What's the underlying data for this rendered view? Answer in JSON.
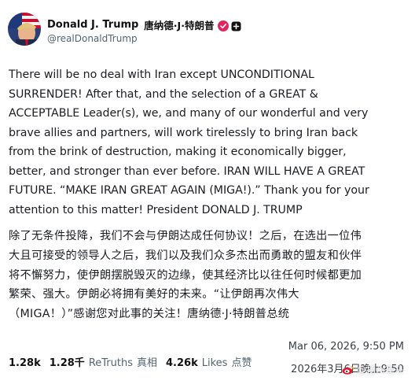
{
  "header": {
    "display_name": "Donald J. Trump",
    "display_name_cn": "唐纳德·J·特朗普",
    "handle": "@realDonaldTrump",
    "verified_icon": "verified-badge-icon",
    "plus_icon": "plus-square-icon",
    "accent_color": "#e0245e"
  },
  "post": {
    "english_lines": [
      "There will be no deal with Iran except UNCONDITIONAL",
      "SURRENDER! After that, and the selection of a GREAT &",
      "ACCEPTABLE Leader(s), we, and many of our wonderful and very",
      "brave allies and partners, will work tirelessly to bring Iran back",
      "from the brink of destruction, making it economically bigger,",
      "better, and stronger than ever before. IRAN WILL HAVE A GREAT",
      "FUTURE. “MAKE IRAN GREAT AGAIN (MIGA!).” Thank you for your",
      "attention to this matter! President DONALD J. TRUMP"
    ],
    "chinese_lines": [
      "除了无条件投降，我们不会与伊朗达成任何协议！之后，在选出一位伟",
      "大且可接受的领导人之后，我们以及我们众多杰出而勇敢的盟友和伙伴",
      "将不懈努力，使伊朗摆脱毁灭的边缘，使其经济比以往任何时候都更加",
      "繁荣、强大。伊朗必将拥有美好的未来。“让伊朗再次伟大",
      "（MIGA！）”感谢您对此事的关注！唐纳德·J·特朗普总统"
    ]
  },
  "footer": {
    "timestamp_en": "Mar 06, 2026, 9:50 PM",
    "timestamp_cn": "2026年3月6日晚上9:50",
    "replies_count": "1.28k",
    "retruths_count": "1.28千",
    "retruths_label": "ReTruths",
    "quotes_label": "真相",
    "likes_count": "4.26k",
    "likes_label": "Likes",
    "likes_label_cn": "点赞"
  },
  "watermark": {
    "text": "@扬州街头",
    "icon": "weibo-icon"
  }
}
